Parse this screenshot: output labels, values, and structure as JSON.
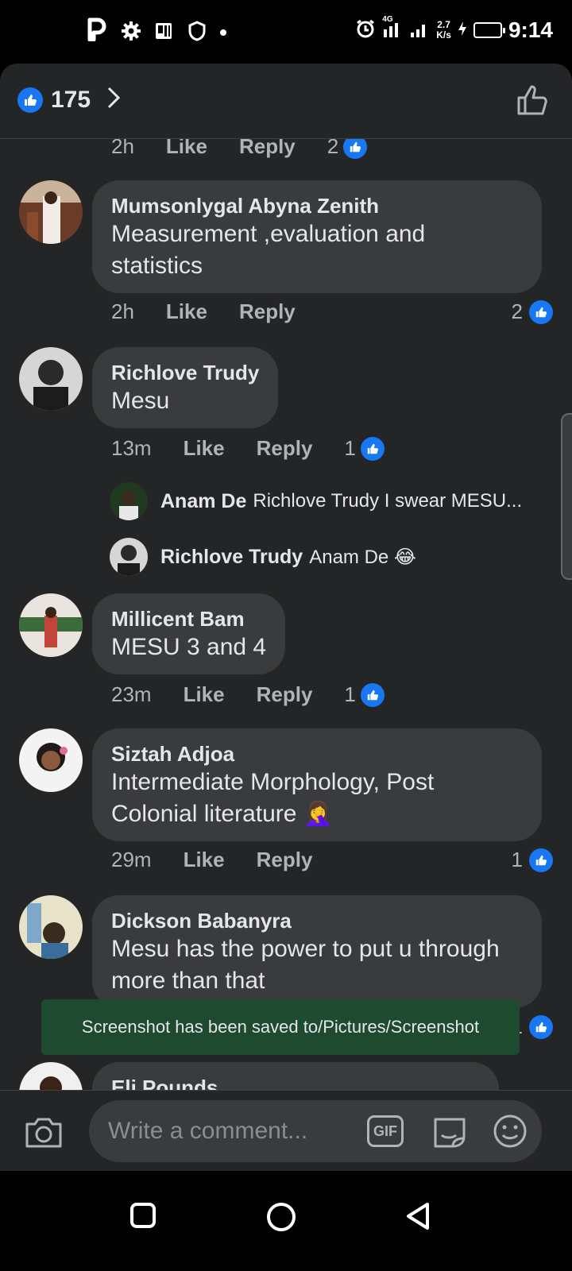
{
  "status_bar": {
    "time": "9:14",
    "network": "4G",
    "speed_value": "2.7",
    "speed_unit": "K/s"
  },
  "reactions": {
    "count": "175"
  },
  "comments": [
    {
      "time": "2h",
      "like": "Like",
      "reply": "Reply",
      "count": "2"
    },
    {
      "author": "Mumsonlygal Abyna Zenith",
      "text_line1": "Measurement ,evaluation and",
      "text_line2": "statistics",
      "time": "2h",
      "like": "Like",
      "reply": "Reply",
      "count": "2"
    },
    {
      "author": "Richlove Trudy",
      "text_line1": "Mesu",
      "time": "13m",
      "like": "Like",
      "reply": "Reply",
      "count": "1"
    },
    {
      "author": "Millicent Bam",
      "text_line1": "MESU 3 and 4",
      "time": "23m",
      "like": "Like",
      "reply": "Reply",
      "count": "1"
    },
    {
      "author": "Siztah Adjoa",
      "text_line1": "Intermediate Morphology, Post",
      "text_line2": "Colonial literature 🤦‍♀️",
      "time": "29m",
      "like": "Like",
      "reply": "Reply",
      "count": "1"
    },
    {
      "author": "Dickson Babanyra",
      "text_line1": "Mesu has the power to put u through",
      "text_line2": "more than that",
      "count": "1"
    },
    {
      "author": "Eli Pounds"
    }
  ],
  "replies": [
    {
      "author": "Anam De",
      "text": "Richlove Trudy I swear MESU..."
    },
    {
      "author": "Richlove Trudy",
      "text": "Anam De 😂"
    }
  ],
  "toast": "Screenshot has been saved to/Pictures/Screenshot",
  "composer": {
    "placeholder": "Write a comment...",
    "gif_label": "GIF"
  },
  "colors": {
    "background": "#242526",
    "bubble": "#3a3b3c",
    "accent": "#1877f2",
    "toast": "#1e4a30"
  }
}
